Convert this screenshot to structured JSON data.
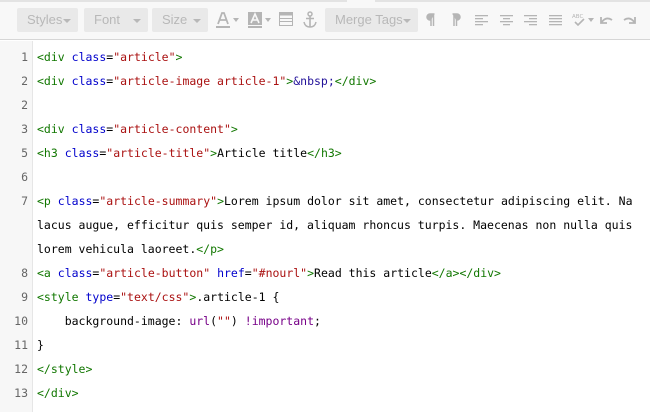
{
  "toolbar": {
    "styles_label": "Styles",
    "font_label": "Font",
    "size_label": "Size",
    "merge_tags_label": "Merge Tags",
    "icons": [
      "text-color-icon",
      "background-color-icon",
      "table-icon",
      "anchor-icon",
      "paragraph-ltr-icon",
      "paragraph-rtl-icon",
      "align-left-icon",
      "align-center-icon",
      "align-right-icon",
      "align-justify-icon",
      "spellcheck-icon",
      "undo-icon",
      "redo-icon"
    ]
  },
  "editor": {
    "lines": [
      {
        "num": "1",
        "tokens": [
          [
            "tag",
            "<div"
          ],
          [
            "txt",
            " "
          ],
          [
            "attr",
            "class"
          ],
          [
            "txt",
            "="
          ],
          [
            "str",
            "\"article\""
          ],
          [
            "tag",
            ">"
          ]
        ]
      },
      {
        "num": "2",
        "tokens": [
          [
            "tag",
            "<div"
          ],
          [
            "txt",
            " "
          ],
          [
            "attr",
            "class"
          ],
          [
            "txt",
            "="
          ],
          [
            "str",
            "\"article-image article-1\""
          ],
          [
            "tag",
            ">"
          ],
          [
            "ent",
            "&nbsp;"
          ],
          [
            "tag",
            "</div>"
          ]
        ]
      },
      {
        "num": "2",
        "tokens": []
      },
      {
        "num": "3",
        "tokens": [
          [
            "tag",
            "<div"
          ],
          [
            "txt",
            " "
          ],
          [
            "attr",
            "class"
          ],
          [
            "txt",
            "="
          ],
          [
            "str",
            "\"article-content\""
          ],
          [
            "tag",
            ">"
          ]
        ]
      },
      {
        "num": "5",
        "tokens": [
          [
            "tag",
            "<h3"
          ],
          [
            "txt",
            " "
          ],
          [
            "attr",
            "class"
          ],
          [
            "txt",
            "="
          ],
          [
            "str",
            "\"article-title\""
          ],
          [
            "tag",
            ">"
          ],
          [
            "txt",
            "Article title"
          ],
          [
            "tag",
            "</h3>"
          ]
        ]
      },
      {
        "num": "6",
        "tokens": []
      },
      {
        "num": "7",
        "wrap": [
          [
            [
              "tag",
              "<p"
            ],
            [
              "txt",
              " "
            ],
            [
              "attr",
              "class"
            ],
            [
              "txt",
              "="
            ],
            [
              "str",
              "\"article-summary\""
            ],
            [
              "tag",
              ">"
            ],
            [
              "txt",
              "Lorem ipsum dolor sit amet, consectetur adipiscing elit. Na"
            ]
          ],
          [
            [
              "txt",
              "lacus augue, efficitur quis semper id, aliquam rhoncus turpis. Maecenas non nulla quis"
            ]
          ],
          [
            [
              "txt",
              "lorem vehicula laoreet."
            ],
            [
              "tag",
              "</p>"
            ]
          ]
        ]
      },
      {
        "num": "8",
        "tokens": [
          [
            "tag",
            "<a"
          ],
          [
            "txt",
            " "
          ],
          [
            "attr",
            "class"
          ],
          [
            "txt",
            "="
          ],
          [
            "str",
            "\"article-button\""
          ],
          [
            "txt",
            " "
          ],
          [
            "attr",
            "href"
          ],
          [
            "txt",
            "="
          ],
          [
            "str",
            "\"#nourl\""
          ],
          [
            "tag",
            ">"
          ],
          [
            "txt",
            "Read this article"
          ],
          [
            "tag",
            "</a></div>"
          ]
        ]
      },
      {
        "num": "9",
        "tokens": [
          [
            "tag",
            "<style"
          ],
          [
            "txt",
            " "
          ],
          [
            "attr",
            "type"
          ],
          [
            "txt",
            "="
          ],
          [
            "str",
            "\"text/css\""
          ],
          [
            "tag",
            ">"
          ],
          [
            "txt",
            ".article-1 {"
          ]
        ]
      },
      {
        "num": "10",
        "tokens": [
          [
            "txt",
            "    background-image: "
          ],
          [
            "kw",
            "url"
          ],
          [
            "txt",
            "("
          ],
          [
            "str",
            "\"\""
          ],
          [
            "txt",
            ") "
          ],
          [
            "kw",
            "!important"
          ],
          [
            "txt",
            ";"
          ]
        ]
      },
      {
        "num": "11",
        "tokens": [
          [
            "txt",
            "}"
          ]
        ]
      },
      {
        "num": "12",
        "tokens": [
          [
            "tag",
            "</style>"
          ]
        ]
      },
      {
        "num": "13",
        "tokens": [
          [
            "tag",
            "</div>"
          ]
        ]
      }
    ]
  },
  "colors": {
    "tag": "#117700",
    "attr": "#0000cc",
    "string": "#aa1111",
    "entity": "#221199",
    "keyword": "#770088"
  }
}
